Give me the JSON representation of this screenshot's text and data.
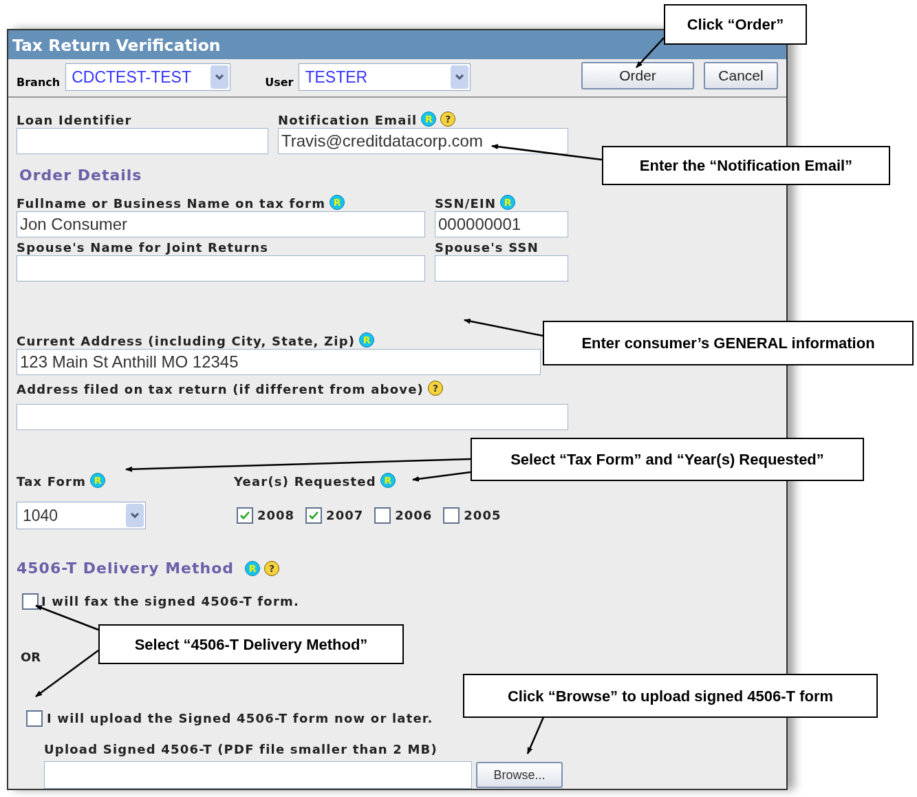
{
  "window": {
    "title": "Tax Return Verification"
  },
  "header": {
    "branch": {
      "label": "Branch",
      "value": "CDCTEST-TEST"
    },
    "user": {
      "label": "User",
      "value": "TESTER"
    },
    "buttons": [
      "Order",
      "Cancel"
    ]
  },
  "loan_identifier": {
    "label": "Loan Identifier"
  },
  "notification_email": {
    "label": "Notification Email",
    "marks": [
      {
        "kind": "required",
        "text": "R"
      },
      {
        "kind": "help",
        "text": "?"
      }
    ],
    "value": "Travis@creditdatacorp.com"
  },
  "order_details": {
    "heading": "Order Details"
  },
  "fullname": {
    "label": "Fullname or Business Name on tax form",
    "marks": [
      {
        "kind": "required",
        "text": "R"
      }
    ],
    "value": "Jon Consumer"
  },
  "ssn": {
    "label": "SSN/EIN",
    "marks": [
      {
        "kind": "required",
        "text": "R"
      }
    ],
    "value": "000000001"
  },
  "spouse_name": {
    "label": "Spouse's Name for Joint Returns"
  },
  "spouse_ssn": {
    "label": "Spouse's SSN"
  },
  "current_address": {
    "label": "Current Address (including City, State, Zip)",
    "marks": [
      {
        "kind": "required",
        "text": "R"
      }
    ],
    "value": "123 Main St Anthill MO 12345"
  },
  "filed_address": {
    "label": "Address filed on tax return (if different from above)",
    "marks": [
      {
        "kind": "help",
        "text": "?"
      }
    ]
  },
  "tax_form": {
    "label": "Tax Form",
    "marks": [
      {
        "kind": "required",
        "text": "R"
      }
    ],
    "value": "1040"
  },
  "years": {
    "label": "Year(s) Requested",
    "marks": [
      {
        "kind": "required",
        "text": "R"
      }
    ],
    "options": [
      {
        "label": "2008",
        "checked": true
      },
      {
        "label": "2007",
        "checked": true
      },
      {
        "label": "2006",
        "checked": false
      },
      {
        "label": "2005",
        "checked": false
      }
    ]
  },
  "delivery": {
    "heading": "4506-T Delivery Method",
    "marks": [
      {
        "kind": "required",
        "text": "R"
      },
      {
        "kind": "help",
        "text": "?"
      }
    ],
    "fax": {
      "label": "I will fax the signed 4506-T form.",
      "checked": false
    },
    "or": "OR",
    "upload": {
      "label": "I will upload the Signed 4506-T form now or later.",
      "checked": false
    },
    "upload_label": "Upload Signed 4506-T (PDF file smaller than 2 MB)",
    "browse": "Browse..."
  },
  "callouts": [
    "Click “Order”",
    "Enter the “Notification Email”",
    "Enter consumer’s GENERAL information",
    "Select “Tax Form” and “Year(s) Requested”",
    "Select “4506-T Delivery Method”",
    "Click “Browse” to upload signed 4506-T form"
  ]
}
